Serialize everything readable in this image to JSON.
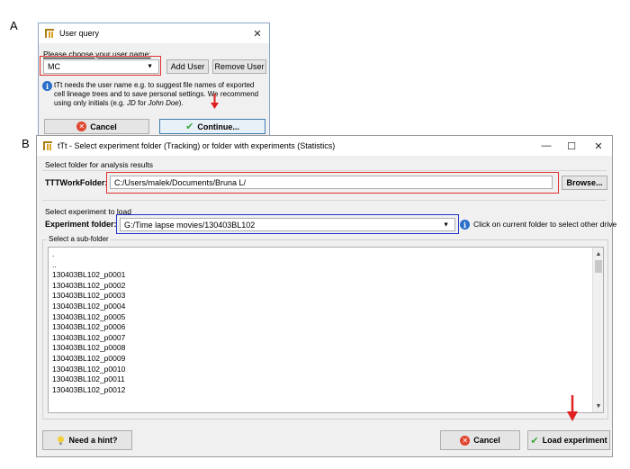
{
  "panel_a": {
    "letter": "A",
    "title": "User query",
    "close_glyph": "✕",
    "prompt_label": "Please choose your user name:",
    "user_value": "MC",
    "add_user_label": "Add User",
    "remove_user_label": "Remove User",
    "info_line1": "tTt needs the user name e.g. to suggest file names of exported",
    "info_line2": "cell lineage trees and to save personal settings. We recommend",
    "info_line3_pre": "using only initials (e.g. ",
    "info_line3_em1": "JD",
    "info_line3_mid": " for ",
    "info_line3_em2": "John Doe",
    "info_line3_post": ").",
    "cancel_label": "Cancel",
    "continue_label": "Continue..."
  },
  "panel_b": {
    "letter": "B",
    "title": "tTt - Select experiment folder (Tracking) or folder with experiments (Statistics)",
    "minimize_glyph": "—",
    "maximize_glyph": "☐",
    "close_glyph": "✕",
    "results_section_label": "Select folder for analysis results",
    "workfolder_label": "TTTWorkFolder:",
    "workfolder_value": "C:/Users/malek/Documents/Bruna L/",
    "browse_label": "Browse...",
    "experiment_section_label": "Select experiment to load",
    "experiment_folder_label": "Experiment folder:",
    "experiment_folder_value": "G:/Time lapse movies/130403BL102",
    "drive_hint": "Click on current folder to select other drive",
    "subfolder_group_label": "Select a sub-folder",
    "subfolders": [
      ".",
      "..",
      "130403BL102_p0001",
      "130403BL102_p0002",
      "130403BL102_p0003",
      "130403BL102_p0004",
      "130403BL102_p0005",
      "130403BL102_p0006",
      "130403BL102_p0007",
      "130403BL102_p0008",
      "130403BL102_p0009",
      "130403BL102_p0010",
      "130403BL102_p0011",
      "130403BL102_p0012"
    ],
    "hint_label": "Need a hint?",
    "cancel_label": "Cancel",
    "load_label": "Load experiment"
  },
  "colors": {
    "highlight_red": "#e03030",
    "highlight_blue": "#2233cc",
    "arrow_red": "#e02020"
  },
  "icons": {
    "app": "ttt-app-icon",
    "info": "info-icon",
    "cancel": "cancel-icon",
    "ok": "check-icon",
    "hint": "lightbulb-icon",
    "combo": "dropdown-arrow-icon"
  }
}
